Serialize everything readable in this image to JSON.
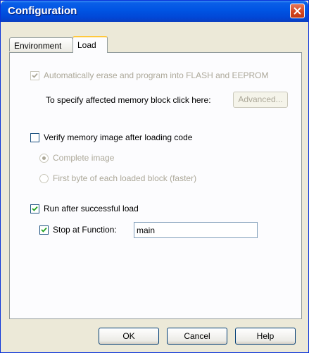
{
  "window": {
    "title": "Configuration"
  },
  "tabs": [
    {
      "label": "Environment"
    },
    {
      "label": "Load"
    }
  ],
  "load": {
    "auto_erase_label": "Automatically erase and program into FLASH and EEPROM",
    "auto_erase_checked": true,
    "specify_block_label": "To specify affected memory block click here:",
    "advanced_button": "Advanced...",
    "verify_label": "Verify memory image after loading code",
    "verify_checked": false,
    "complete_image_label": "Complete image",
    "first_byte_label": "First byte of each loaded block (faster)",
    "run_after_label": "Run after successful load",
    "run_after_checked": true,
    "stop_at_label": "Stop at Function:",
    "stop_at_checked": true,
    "stop_at_value": "main"
  },
  "buttons": {
    "ok": "OK",
    "cancel": "Cancel",
    "help": "Help"
  },
  "colors": {
    "titlebar": "#0054e3",
    "close": "#d3431c",
    "tab_highlight": "#ffc83c",
    "dialog_bg": "#ece9d8"
  }
}
